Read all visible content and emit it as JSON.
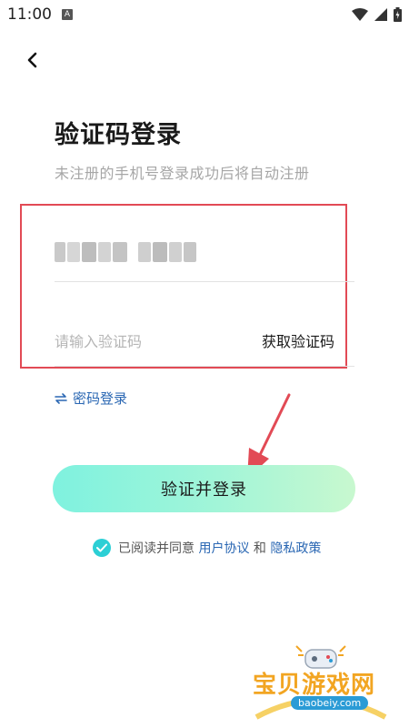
{
  "status_bar": {
    "time": "11:00",
    "notification_badge": "A"
  },
  "header": {
    "back_icon": "chevron-left-icon"
  },
  "title": "验证码登录",
  "subtitle": "未注册的手机号登录成功后将自动注册",
  "form": {
    "phone_value_blurred": true,
    "code_placeholder": "请输入验证码",
    "get_code_label": "获取验证码",
    "highlight_color": "#e24a55"
  },
  "password_login_label": "密码登录",
  "submit_label": "验证并登录",
  "agreement": {
    "checked": true,
    "prefix": "已阅读并同意",
    "user_agreement": "用户协议",
    "conjunction": "和",
    "privacy_policy": "隐私政策"
  },
  "watermark": {
    "name": "宝贝游戏网",
    "url": "baobeiy.com"
  },
  "colors": {
    "accent_link": "#2a67b3",
    "checkbox": "#2ccfd5",
    "button_start": "#7ff2df",
    "button_end": "#c8f8cf"
  }
}
